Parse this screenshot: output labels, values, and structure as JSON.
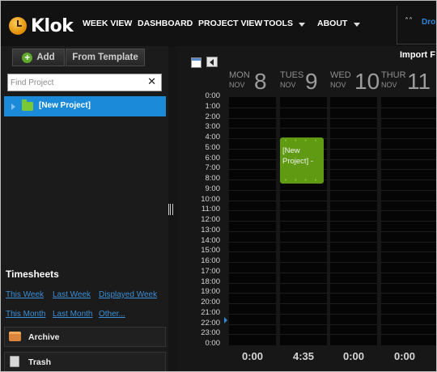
{
  "header": {
    "app_name": "Klok",
    "nav": [
      "WEEK VIEW",
      "DASHBOARD",
      "PROJECT VIEW",
      "TOOLS",
      "ABOUT"
    ],
    "drop_label": "Drop"
  },
  "sidebar": {
    "add_label": "Add",
    "from_template_label": "From Template",
    "search_placeholder": "Find Project",
    "project_label": "[New Project]",
    "timesheets_title": "Timesheets",
    "links": [
      "This Week",
      "Last Week",
      "Displayed Week",
      "This Month",
      "Last Month",
      "Other..."
    ],
    "archive_label": "Archive",
    "trash_label": "Trash"
  },
  "calendar": {
    "import_label": "Import F",
    "days": [
      {
        "name": "MON",
        "month": "NOV",
        "num": "8"
      },
      {
        "name": "TUES",
        "month": "NOV",
        "num": "9"
      },
      {
        "name": "WED",
        "month": "NOV",
        "num": "10"
      },
      {
        "name": "THUR",
        "month": "NOV",
        "num": "11"
      }
    ],
    "hours": [
      "0:00",
      "1:00",
      "2:00",
      "3:00",
      "4:00",
      "5:00",
      "6:00",
      "7:00",
      "8:00",
      "9:00",
      "10:00",
      "11:00",
      "12:00",
      "13:00",
      "14:00",
      "15:00",
      "16:00",
      "17:00",
      "18:00",
      "19:00",
      "20:00",
      "21:00",
      "22:00",
      "23:00",
      "0:00"
    ],
    "event": {
      "label": "[New Project] -",
      "color": "#5f9a12"
    },
    "totals": [
      "0:00",
      "4:35",
      "0:00",
      "0:00"
    ]
  },
  "colors": {
    "accent": "#1b8bd9",
    "link": "#3a8fd8",
    "event_green": "#5f9a12"
  }
}
